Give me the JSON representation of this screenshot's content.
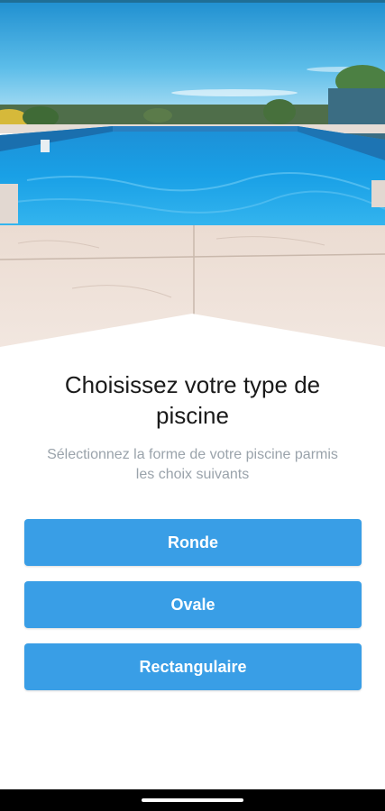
{
  "screen": {
    "title": "Choisissez votre type de piscine",
    "subtitle": "Sélectionnez la forme de votre piscine parmis les choix suivants"
  },
  "options": [
    {
      "label": "Ronde"
    },
    {
      "label": "Ovale"
    },
    {
      "label": "Rectangulaire"
    }
  ],
  "colors": {
    "button": "#399ee6",
    "button_text": "#ffffff",
    "title": "#1a1a1a",
    "subtitle": "#9aa3ab"
  },
  "icons": {
    "hero": "pool-photo",
    "nav": "gesture-nav-handle"
  }
}
